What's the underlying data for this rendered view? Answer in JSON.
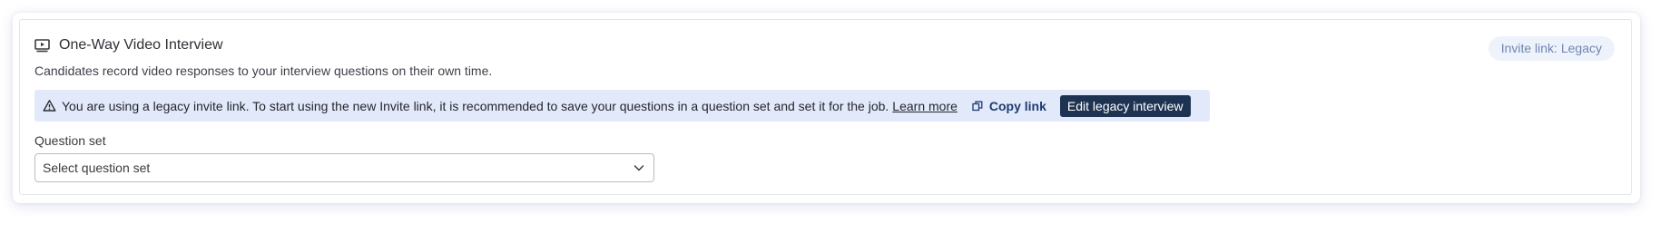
{
  "section": {
    "title": "One-Way Video Interview",
    "subtitle": "Candidates record video responses to your interview questions on their own time.",
    "badge": "Invite link: Legacy",
    "icon": "video-play-icon"
  },
  "alert": {
    "icon": "warning-triangle-icon",
    "message": "You are using a legacy invite link. To start using the new Invite link, it is recommended to save your questions in a question set and set it for the job.",
    "learn_more": "Learn more",
    "copy_link": "Copy link",
    "copy_icon": "copy-icon",
    "edit_button": "Edit legacy interview",
    "background": "#e2e9fb"
  },
  "question_set": {
    "label": "Question set",
    "placeholder": "Select question set",
    "chevron_icon": "chevron-down-icon"
  },
  "colors": {
    "primary_dark": "#1e3352",
    "link_blue": "#1e3c70",
    "badge_bg": "#eef2fb",
    "badge_text": "#6f86b2"
  }
}
